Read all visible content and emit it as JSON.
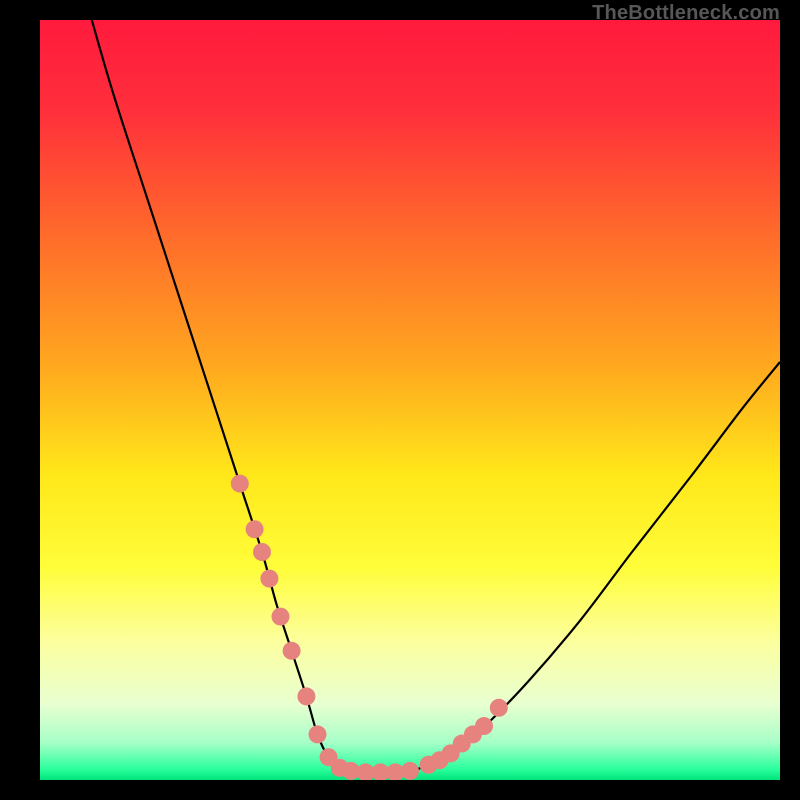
{
  "watermark": "TheBottleneck.com",
  "chart_data": {
    "type": "line",
    "title": "",
    "xlabel": "",
    "ylabel": "",
    "xlim": [
      0,
      100
    ],
    "ylim": [
      0,
      100
    ],
    "grid": false,
    "legend": false,
    "gradient_stops": [
      {
        "offset": 0.0,
        "color": "#ff1a3d"
      },
      {
        "offset": 0.12,
        "color": "#ff2f3b"
      },
      {
        "offset": 0.28,
        "color": "#ff6a2b"
      },
      {
        "offset": 0.45,
        "color": "#ffa61f"
      },
      {
        "offset": 0.6,
        "color": "#ffe81a"
      },
      {
        "offset": 0.72,
        "color": "#fffd3a"
      },
      {
        "offset": 0.82,
        "color": "#fcffa0"
      },
      {
        "offset": 0.9,
        "color": "#e8ffd0"
      },
      {
        "offset": 0.95,
        "color": "#a8ffc8"
      },
      {
        "offset": 0.985,
        "color": "#2eff9f"
      },
      {
        "offset": 1.0,
        "color": "#00e47a"
      }
    ],
    "series": [
      {
        "name": "bottleneck-curve",
        "x": [
          7,
          10,
          15,
          20,
          24,
          27,
          30,
          32,
          34,
          36,
          37.5,
          39,
          41,
          43,
          46,
          50,
          55,
          60,
          66,
          73,
          80,
          88,
          95,
          100
        ],
        "y": [
          100,
          90,
          75,
          60,
          48,
          39,
          30,
          23,
          17,
          11,
          6,
          3,
          1.2,
          1.0,
          1.0,
          1.2,
          3,
          7,
          13,
          21,
          30,
          40,
          49,
          55
        ]
      }
    ],
    "scatter_points": {
      "name": "highlight-dots",
      "x": [
        27,
        29,
        30,
        31,
        32.5,
        34,
        36,
        37.5,
        39,
        40.5,
        42,
        44,
        46,
        48,
        50,
        52.5,
        54,
        55.5,
        57,
        58.5,
        60,
        62
      ],
      "y": [
        39,
        33,
        30,
        26.5,
        21.5,
        17,
        11,
        6,
        3,
        1.6,
        1.2,
        1.0,
        1.0,
        1.0,
        1.2,
        2.0,
        2.6,
        3.5,
        4.8,
        6.0,
        7.1,
        9.5
      ],
      "color": "#e7837f",
      "radius": 9
    }
  }
}
